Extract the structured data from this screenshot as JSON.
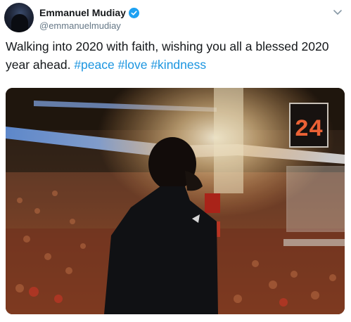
{
  "tweet": {
    "display_name": "Emmanuel Mudiay",
    "handle": "@emmanuelmudiay",
    "text_plain": "Walking into 2020 with faith, wishing you all a blessed 2020 year ahead.",
    "hashtags": [
      "#peace",
      "#love",
      "#kindness"
    ],
    "verified": true,
    "shot_clock": "24"
  },
  "icons": {
    "avatar": "avatar",
    "verified": "verified-badge-icon",
    "more": "chevron-down-icon"
  },
  "colors": {
    "text": "#14171a",
    "secondary": "#657786",
    "hashtag": "#1b95e0",
    "verified": "#1da1f2"
  }
}
